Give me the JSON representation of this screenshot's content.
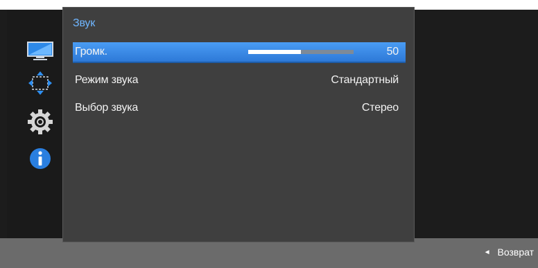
{
  "menu": {
    "title": "Звук",
    "items": [
      {
        "label": "Громк.",
        "value": "50",
        "level": 50,
        "selected": true
      },
      {
        "label": "Режим звука",
        "value": "Стандартный"
      },
      {
        "label": "Выбор звука",
        "value": "Стерео"
      }
    ]
  },
  "sidebar": {
    "icons": [
      "monitor-icon",
      "move-arrows-icon",
      "gear-icon",
      "info-icon"
    ],
    "colors": {
      "accent": "#3f93f0",
      "info": "#2a7fe0"
    }
  },
  "footer": {
    "back_label": "Возврат",
    "back_icon": "triangle-left-icon"
  }
}
